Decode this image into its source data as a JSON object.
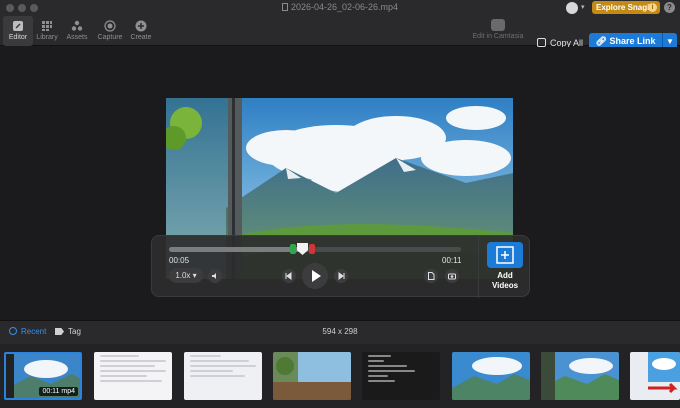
{
  "window": {
    "title": "2026-04-26_02-06-26.mp4"
  },
  "toolbar": {
    "tabs": [
      {
        "label": "Editor",
        "icon": "editor-icon"
      },
      {
        "label": "Library",
        "icon": "library-icon"
      },
      {
        "label": "Assets",
        "icon": "assets-icon"
      },
      {
        "label": "Capture",
        "icon": "capture-icon"
      },
      {
        "label": "Create",
        "icon": "create-icon"
      }
    ],
    "camtasia_label": "Edit in Camtasia",
    "explore_label": "Explore Snagit",
    "explore_info": "i",
    "help": "?",
    "copy_all": "Copy All",
    "share_link": "Share Link"
  },
  "player": {
    "current_time": "00:05",
    "duration": "00:11",
    "speed": "1.0x",
    "progress_fraction": 0.45,
    "add_videos_line1": "Add",
    "add_videos_line2": "Videos"
  },
  "tray": {
    "recent_label": "Recent",
    "tag_label": "Tag",
    "dimensions": "594 x 298",
    "selected_thumb_label": "00:11 mp4"
  },
  "colors": {
    "accent": "#1d7bd8",
    "explore": "#c48a16",
    "trim_start": "#2ea84a",
    "trim_end": "#d53434"
  }
}
